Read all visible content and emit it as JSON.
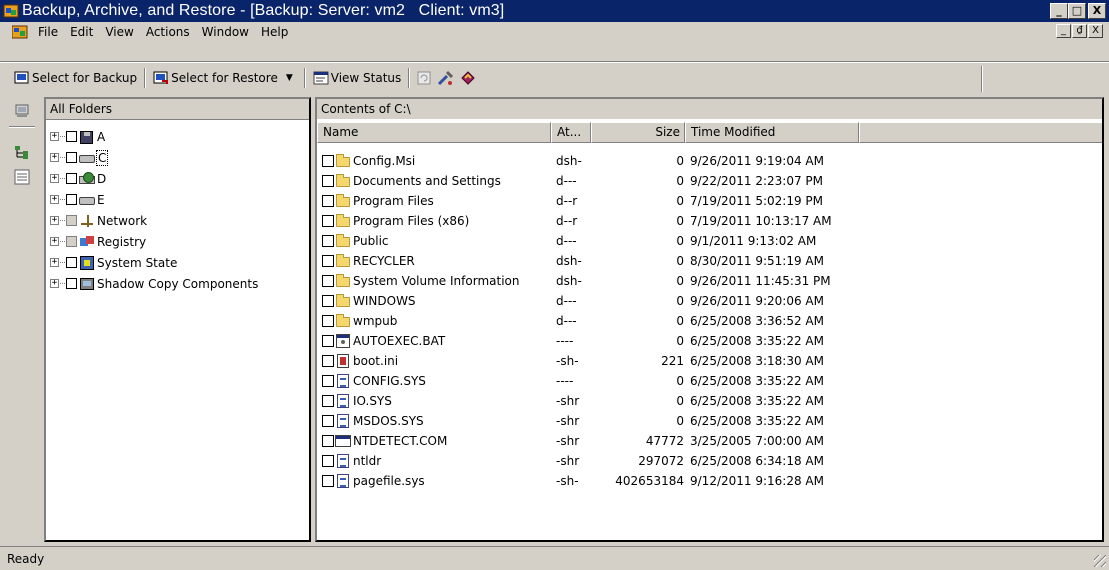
{
  "window": {
    "title": "Backup, Archive, and Restore - [Backup: Server: vm2   Client: vm3]",
    "controls": [
      "_",
      "□",
      "X"
    ]
  },
  "menu": {
    "items": [
      "File",
      "Edit",
      "View",
      "Actions",
      "Window",
      "Help"
    ],
    "mdi_controls": [
      "_",
      "₫",
      "X"
    ]
  },
  "toolbar": {
    "select_for_backup": "Select for Backup",
    "select_for_restore": "Select for Restore",
    "view_status": "View Status"
  },
  "tree": {
    "header": "All Folders",
    "items": [
      {
        "label": "A",
        "icon": "floppy-drive-icon"
      },
      {
        "label": "C",
        "icon": "hard-drive-icon"
      },
      {
        "label": "D",
        "icon": "cdrom-drive-icon"
      },
      {
        "label": "E",
        "icon": "hard-drive-icon"
      },
      {
        "label": "Network",
        "icon": "network-icon"
      },
      {
        "label": "Registry",
        "icon": "registry-icon"
      },
      {
        "label": "System State",
        "icon": "system-state-icon"
      },
      {
        "label": "Shadow Copy Components",
        "icon": "shadow-copy-icon"
      }
    ]
  },
  "contents": {
    "header": "Contents of C:\\",
    "columns": {
      "name": "Name",
      "attr": "At...",
      "size": "Size",
      "time": "Time Modified"
    },
    "rows": [
      {
        "name": "Config.Msi",
        "attr": "dsh-",
        "size": "0",
        "time": "9/26/2011 9:19:04 AM",
        "icon": "folder"
      },
      {
        "name": "Documents and Settings",
        "attr": "d---",
        "size": "0",
        "time": "9/22/2011 2:23:07 PM",
        "icon": "folder"
      },
      {
        "name": "Program Files",
        "attr": "d--r",
        "size": "0",
        "time": "7/19/2011 5:02:19 PM",
        "icon": "folder"
      },
      {
        "name": "Program Files (x86)",
        "attr": "d--r",
        "size": "0",
        "time": "7/19/2011 10:13:17 AM",
        "icon": "folder"
      },
      {
        "name": "Public",
        "attr": "d---",
        "size": "0",
        "time": "9/1/2011 9:13:02 AM",
        "icon": "folder"
      },
      {
        "name": "RECYCLER",
        "attr": "dsh-",
        "size": "0",
        "time": "8/30/2011 9:51:19 AM",
        "icon": "folder"
      },
      {
        "name": "System Volume Information",
        "attr": "dsh-",
        "size": "0",
        "time": "9/26/2011 11:45:31 PM",
        "icon": "folder"
      },
      {
        "name": "WINDOWS",
        "attr": "d---",
        "size": "0",
        "time": "9/26/2011 9:20:06 AM",
        "icon": "folder"
      },
      {
        "name": "wmpub",
        "attr": "d---",
        "size": "0",
        "time": "6/25/2008 3:36:52 AM",
        "icon": "folder"
      },
      {
        "name": "AUTOEXEC.BAT",
        "attr": "----",
        "size": "0",
        "time": "6/25/2008 3:35:22 AM",
        "icon": "batch"
      },
      {
        "name": "boot.ini",
        "attr": "-sh-",
        "size": "221",
        "time": "6/25/2008 3:18:30 AM",
        "icon": "ini"
      },
      {
        "name": "CONFIG.SYS",
        "attr": "----",
        "size": "0",
        "time": "6/25/2008 3:35:22 AM",
        "icon": "sys"
      },
      {
        "name": "IO.SYS",
        "attr": "-shr",
        "size": "0",
        "time": "6/25/2008 3:35:22 AM",
        "icon": "sys"
      },
      {
        "name": "MSDOS.SYS",
        "attr": "-shr",
        "size": "0",
        "time": "6/25/2008 3:35:22 AM",
        "icon": "sys"
      },
      {
        "name": "NTDETECT.COM",
        "attr": "-shr",
        "size": "47772",
        "time": "3/25/2005 7:00:00 AM",
        "icon": "com"
      },
      {
        "name": "ntldr",
        "attr": "-shr",
        "size": "297072",
        "time": "6/25/2008 6:34:18 AM",
        "icon": "sys"
      },
      {
        "name": "pagefile.sys",
        "attr": "-sh-",
        "size": "402653184",
        "time": "9/12/2011 9:16:28 AM",
        "icon": "sys"
      }
    ]
  },
  "status": {
    "text": "Ready"
  },
  "colors": {
    "titlebar": "#0a246a",
    "face": "#d4d0c8",
    "folder": "#f5d76e"
  }
}
